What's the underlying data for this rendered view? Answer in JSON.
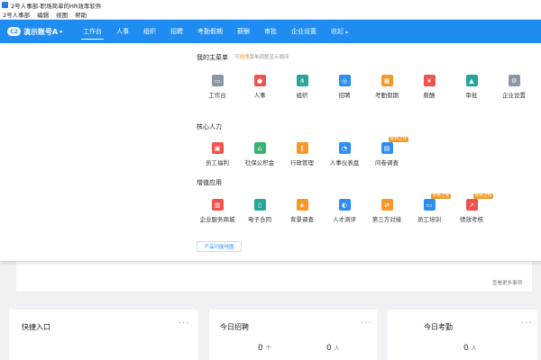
{
  "window": {
    "title": "2号人事部-职场简单的HR效率软件"
  },
  "menubar": {
    "items": [
      "2号人事部",
      "编辑",
      "视图",
      "帮助"
    ]
  },
  "navbar": {
    "account": "演示账号A",
    "logo_text": "C2",
    "tabs": [
      "工作台",
      "人事",
      "组织",
      "招聘",
      "考勤假期",
      "薪酬",
      "审批",
      "企业设置",
      "收起"
    ],
    "active_tab": "工作台"
  },
  "mega_menu": {
    "main_menu": {
      "title": "我的主菜单",
      "hint_prefix": "可",
      "hint_highlight": "拖拽",
      "hint_suffix": "菜单调整显示顺序",
      "items": [
        {
          "label": "工作台",
          "icon": "monitor-icon",
          "color": "#8c96a6"
        },
        {
          "label": "人事",
          "icon": "person-icon",
          "color": "#ef5350"
        },
        {
          "label": "组织",
          "icon": "org-icon",
          "color": "#26a69a"
        },
        {
          "label": "招聘",
          "icon": "recruit-icon",
          "color": "#2b8ef0"
        },
        {
          "label": "考勤假期",
          "icon": "calendar-icon",
          "color": "#f7972a"
        },
        {
          "label": "薪酬",
          "icon": "salary-icon",
          "color": "#ef5350"
        },
        {
          "label": "审批",
          "icon": "approval-icon",
          "color": "#26a69a"
        },
        {
          "label": "企业设置",
          "icon": "gear-icon",
          "color": "#8c96a6"
        }
      ]
    },
    "core_hr": {
      "title": "核心人力",
      "items": [
        {
          "label": "员工福利",
          "icon": "gift-icon",
          "color": "#ef5350",
          "tag": ""
        },
        {
          "label": "社保公积金",
          "icon": "house-icon",
          "color": "#3bb273",
          "tag": ""
        },
        {
          "label": "行政管理",
          "icon": "books-icon",
          "color": "#f7972a",
          "tag": ""
        },
        {
          "label": "人事仪表盘",
          "icon": "pie-chart-icon",
          "color": "#2b8ef0",
          "tag": ""
        },
        {
          "label": "问卷调查",
          "icon": "survey-icon",
          "color": "#2b8ef0",
          "tag": "即将上线"
        }
      ]
    },
    "value_added": {
      "title": "增值应用",
      "items": [
        {
          "label": "企业服务商城",
          "icon": "shop-icon",
          "color": "#ef5350",
          "tag": ""
        },
        {
          "label": "电子合同",
          "icon": "contract-icon",
          "color": "#26a69a",
          "tag": ""
        },
        {
          "label": "背景调查",
          "icon": "background-check-icon",
          "color": "#f7972a",
          "tag": ""
        },
        {
          "label": "人才测评",
          "icon": "talent-assess-icon",
          "color": "#2b8ef0",
          "tag": ""
        },
        {
          "label": "第三方对接",
          "icon": "integration-icon",
          "color": "#f7972a",
          "tag": ""
        },
        {
          "label": "员工培训",
          "icon": "training-icon",
          "color": "#2b8ef0",
          "tag": "即将上线"
        },
        {
          "label": "绩效考核",
          "icon": "performance-icon",
          "color": "#ef5350",
          "tag": "即将上线"
        }
      ]
    },
    "func_button": "产品功能地图"
  },
  "background": {
    "more_link": "查看更多事项",
    "cards": [
      {
        "title": "快捷入口",
        "more": "···"
      },
      {
        "title": "今日招聘",
        "more": "···",
        "value": "0",
        "unit": "个",
        "value2": "0",
        "unit2": "人"
      },
      {
        "title": "今日考勤",
        "more": "···",
        "value": "0",
        "unit": "人"
      }
    ]
  }
}
